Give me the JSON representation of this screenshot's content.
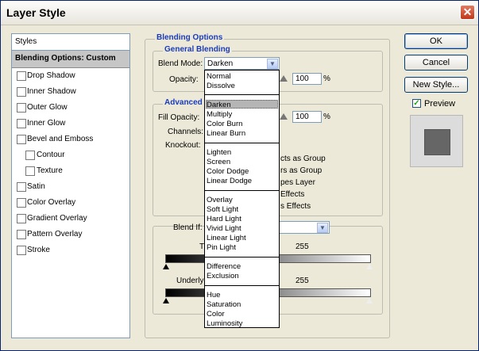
{
  "window": {
    "title": "Layer Style",
    "close_glyph": "✕"
  },
  "stylelist": {
    "header": "Styles",
    "selected": "Blending Options: Custom",
    "items": [
      {
        "label": "Drop Shadow",
        "checked": false
      },
      {
        "label": "Inner Shadow",
        "checked": false
      },
      {
        "label": "Outer Glow",
        "checked": false
      },
      {
        "label": "Inner Glow",
        "checked": false
      },
      {
        "label": "Bevel and Emboss",
        "checked": false
      },
      {
        "label": "Contour",
        "checked": false
      },
      {
        "label": "Texture",
        "checked": false
      },
      {
        "label": "Satin",
        "checked": false
      },
      {
        "label": "Color Overlay",
        "checked": false
      },
      {
        "label": "Gradient Overlay",
        "checked": false
      },
      {
        "label": "Pattern Overlay",
        "checked": false
      },
      {
        "label": "Stroke",
        "checked": false
      }
    ]
  },
  "blending": {
    "title": "Blending Options",
    "general": {
      "title": "General Blending",
      "blend_mode_label": "Blend Mode:",
      "blend_mode_value": "Darken",
      "opacity_label": "Opacity:",
      "opacity_value": "100",
      "opacity_unit": "%"
    },
    "advanced": {
      "title": "Advanced",
      "fill_opacity_label": "Fill Opacity:",
      "fill_opacity_value": "100",
      "fill_unit": "%",
      "channels_label": "Channels:",
      "knockout_label": "Knockout:",
      "opt1": "cts as Group",
      "opt2": "rs as Group",
      "opt3": "pes Layer",
      "opt4": "Effects",
      "opt5": "s Effects"
    },
    "blendif": {
      "label": "Blend If:",
      "this_label": "Th",
      "this_max": "255",
      "under_label": "Underly",
      "under_max": "255"
    }
  },
  "dropdown": {
    "groups": [
      [
        "Normal",
        "Dissolve"
      ],
      [
        "Darken",
        "Multiply",
        "Color Burn",
        "Linear Burn"
      ],
      [
        "Lighten",
        "Screen",
        "Color Dodge",
        "Linear Dodge"
      ],
      [
        "Overlay",
        "Soft Light",
        "Hard Light",
        "Vivid Light",
        "Linear Light",
        "Pin Light"
      ],
      [
        "Difference",
        "Exclusion"
      ],
      [
        "Hue",
        "Saturation",
        "Color",
        "Luminosity"
      ]
    ],
    "highlighted": "Darken"
  },
  "buttons": {
    "ok": "OK",
    "cancel": "Cancel",
    "new_style": "New Style..."
  },
  "preview": {
    "label": "Preview",
    "checked": true,
    "check_glyph": "✓"
  },
  "colors": {
    "group_title": "#1a3cbc",
    "swatch": "#666666",
    "highlight": "#b5b5b5"
  }
}
